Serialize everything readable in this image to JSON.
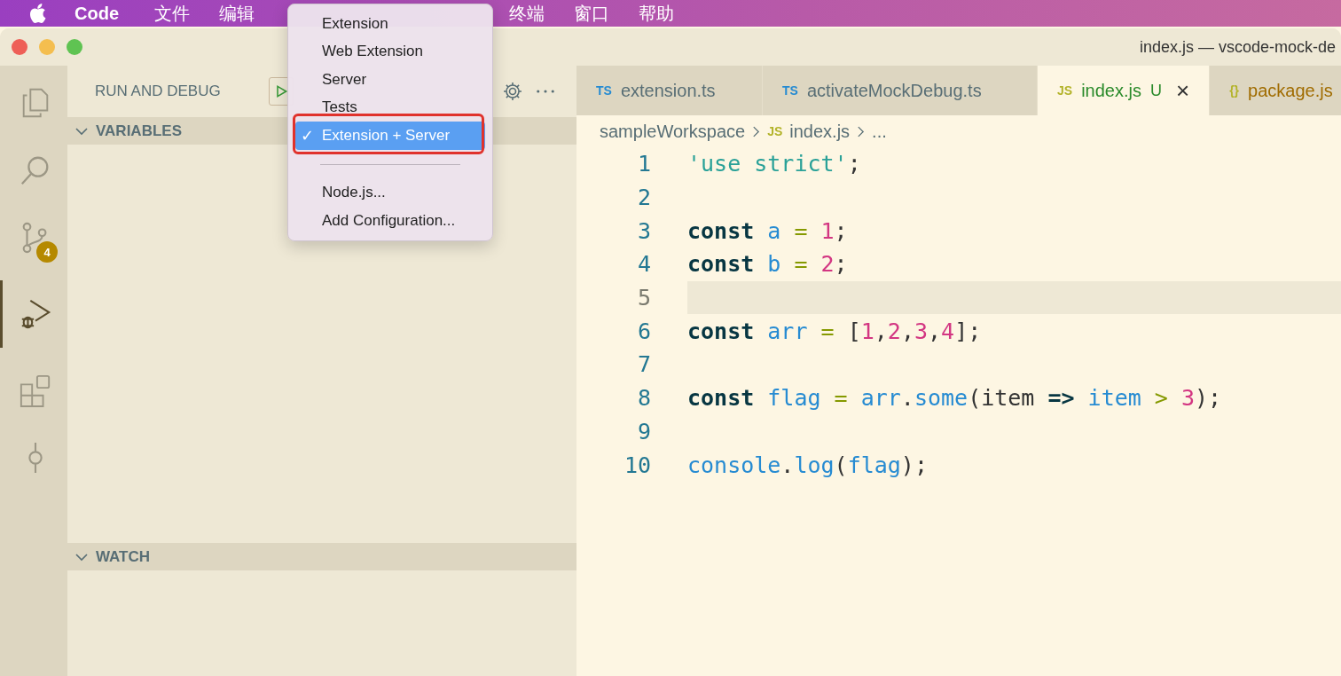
{
  "menu_bar": {
    "items": [
      {
        "label": "Code",
        "kind": "app"
      },
      {
        "label": "文件",
        "kind": "menu"
      },
      {
        "label": "编辑",
        "kind": "menu"
      },
      {
        "label": "终端",
        "kind": "after_gap"
      },
      {
        "label": "窗口",
        "kind": "menu"
      },
      {
        "label": "帮助",
        "kind": "menu"
      }
    ]
  },
  "window": {
    "title": "index.js — vscode-mock-de"
  },
  "activity_bar": {
    "items": [
      {
        "kind": "files",
        "selected": false
      },
      {
        "kind": "search",
        "selected": false
      },
      {
        "kind": "git",
        "selected": false,
        "badge": "4"
      },
      {
        "kind": "debug",
        "selected": true
      },
      {
        "kind": "extensions",
        "selected": false
      },
      {
        "kind": "commit",
        "selected": false
      }
    ]
  },
  "sidebar": {
    "title": "RUN AND DEBUG",
    "sections": [
      {
        "label": "VARIABLES",
        "expanded": true
      },
      {
        "label": "WATCH",
        "expanded": true
      }
    ]
  },
  "launch_menu": {
    "items": [
      {
        "label": "Extension",
        "kind": "item",
        "checked": false
      },
      {
        "label": "Web Extension",
        "kind": "item",
        "checked": false
      },
      {
        "label": "Server",
        "kind": "item",
        "checked": false
      },
      {
        "label": "Tests",
        "kind": "item",
        "checked": false
      },
      {
        "label": "Extension + Server",
        "kind": "item",
        "checked": true,
        "check": "✓"
      },
      {
        "kind": "separator"
      },
      {
        "label": "Node.js...",
        "kind": "item",
        "checked": false
      },
      {
        "label": "Add Configuration...",
        "kind": "item",
        "checked": false
      }
    ]
  },
  "tabs": [
    {
      "badge": {
        "text": "TS",
        "color": "#268bd2"
      },
      "label": "extension.ts",
      "selected": false,
      "color": "#586e75"
    },
    {
      "badge": {
        "text": "TS",
        "color": "#268bd2"
      },
      "label": "activateMockDebug.ts",
      "selected": false,
      "color": "#586e75"
    },
    {
      "badge": {
        "text": "JS",
        "color": "#b3b32a"
      },
      "label": "index.js",
      "selected": true,
      "color": "#2a8a2a",
      "status": "U",
      "close": "×"
    },
    {
      "badge": {
        "text": "{}",
        "color": "#b3b32a"
      },
      "label": "package.js",
      "selected": false,
      "color": "#a06c00"
    }
  ],
  "breadcrumb": [
    {
      "label": "sampleWorkspace"
    },
    {
      "label": "index.js",
      "badge": "JS"
    },
    {
      "label": "..."
    }
  ],
  "code": [
    {
      "n": "1",
      "current": false,
      "tokens": [
        {
          "t": "'use strict'",
          "kind": "str"
        },
        {
          "t": ";",
          "kind": "punc"
        }
      ]
    },
    {
      "n": "2",
      "current": false
    },
    {
      "n": "3",
      "current": false,
      "tokens": [
        {
          "t": "const ",
          "kind": "kw"
        },
        {
          "t": "a",
          "kind": "var"
        },
        {
          "t": " = ",
          "kind": "op"
        },
        {
          "t": "1",
          "kind": "num"
        },
        {
          "t": ";",
          "kind": "punc"
        }
      ]
    },
    {
      "n": "4",
      "current": false,
      "tokens": [
        {
          "t": "const ",
          "kind": "kw"
        },
        {
          "t": "b",
          "kind": "var"
        },
        {
          "t": " = ",
          "kind": "op"
        },
        {
          "t": "2",
          "kind": "num"
        },
        {
          "t": ";",
          "kind": "punc"
        }
      ]
    },
    {
      "n": "5",
      "current": true
    },
    {
      "n": "6",
      "current": false,
      "tokens": [
        {
          "t": "const ",
          "kind": "kw"
        },
        {
          "t": "arr",
          "kind": "var"
        },
        {
          "t": " = ",
          "kind": "op"
        },
        {
          "t": "[",
          "kind": "punc"
        },
        {
          "t": "1",
          "kind": "num"
        },
        {
          "t": ",",
          "kind": "punc"
        },
        {
          "t": "2",
          "kind": "num"
        },
        {
          "t": ",",
          "kind": "punc"
        },
        {
          "t": "3",
          "kind": "num"
        },
        {
          "t": ",",
          "kind": "punc"
        },
        {
          "t": "4",
          "kind": "num"
        },
        {
          "t": "];",
          "kind": "punc"
        }
      ]
    },
    {
      "n": "7",
      "current": false
    },
    {
      "n": "8",
      "current": false,
      "tokens": [
        {
          "t": "const ",
          "kind": "kw"
        },
        {
          "t": "flag",
          "kind": "var"
        },
        {
          "t": " = ",
          "kind": "op"
        },
        {
          "t": "arr",
          "kind": "var"
        },
        {
          "t": ".",
          "kind": "punc"
        },
        {
          "t": "some",
          "kind": "var"
        },
        {
          "t": "(item ",
          "kind": "punc"
        },
        {
          "t": "=> ",
          "kind": "kw"
        },
        {
          "t": "item",
          "kind": "var"
        },
        {
          "t": " > ",
          "kind": "op"
        },
        {
          "t": "3",
          "kind": "num"
        },
        {
          "t": ");",
          "kind": "punc"
        }
      ]
    },
    {
      "n": "9",
      "current": false
    },
    {
      "n": "10",
      "current": false,
      "tokens": [
        {
          "t": "console",
          "kind": "var"
        },
        {
          "t": ".",
          "kind": "punc"
        },
        {
          "t": "log",
          "kind": "var"
        },
        {
          "t": "(",
          "kind": "punc"
        },
        {
          "t": "flag",
          "kind": "var"
        },
        {
          "t": ");",
          "kind": "punc"
        }
      ]
    }
  ]
}
